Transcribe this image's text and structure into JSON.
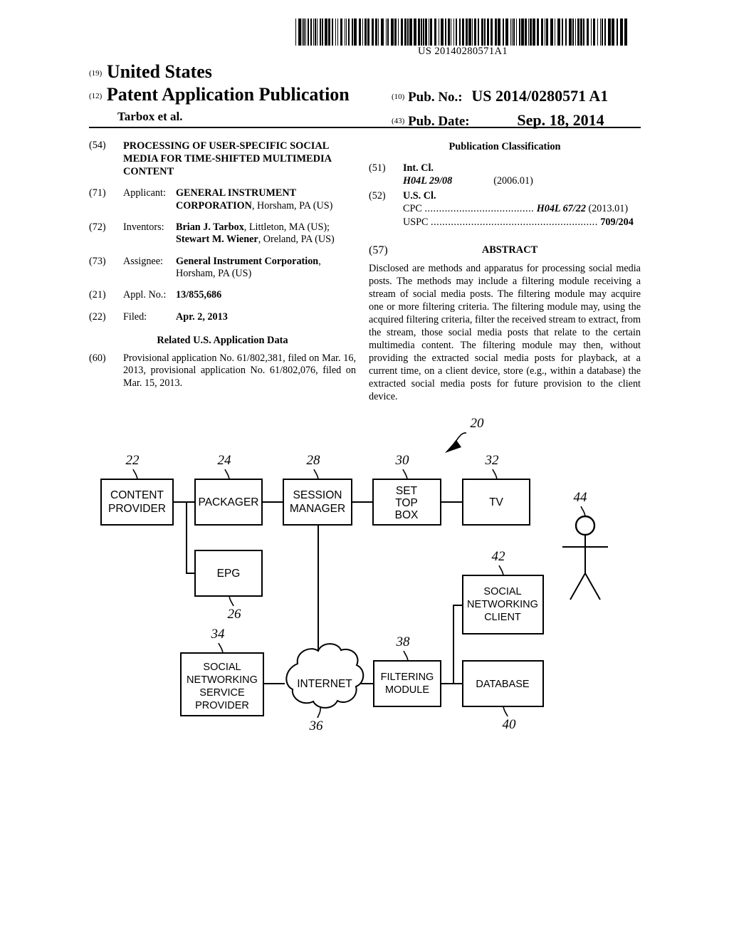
{
  "barcode": {
    "publication_number_text": "US 20140280571A1"
  },
  "masthead": {
    "code_19": "(19)",
    "country": "United States",
    "code_12": "(12)",
    "doc_type": "Patent Application Publication",
    "authors": "Tarbox et al.",
    "code_10": "(10)",
    "pub_no_label": "Pub. No.:",
    "pub_no_value": "US 2014/0280571 A1",
    "code_43": "(43)",
    "pub_date_label": "Pub. Date:",
    "pub_date_value": "Sep. 18, 2014"
  },
  "left_column": {
    "title": {
      "code": "(54)",
      "text": "PROCESSING OF USER-SPECIFIC SOCIAL MEDIA FOR TIME-SHIFTED MULTIMEDIA CONTENT"
    },
    "applicant": {
      "code": "(71)",
      "label": "Applicant:",
      "name": "GENERAL INSTRUMENT CORPORATION",
      "location": ", Horsham, PA (US)"
    },
    "inventors": {
      "code": "(72)",
      "label": "Inventors:",
      "entries": [
        {
          "name": "Brian J. Tarbox",
          "location": ", Littleton, MA (US);"
        },
        {
          "name": "Stewart M. Wiener",
          "location": ", Oreland, PA (US)"
        }
      ]
    },
    "assignee": {
      "code": "(73)",
      "label": "Assignee:",
      "name": "General Instrument Corporation",
      "location": ",",
      "location2": "Horsham, PA (US)"
    },
    "appl_no": {
      "code": "(21)",
      "label": "Appl. No.:",
      "value": "13/855,686"
    },
    "filed": {
      "code": "(22)",
      "label": "Filed:",
      "value": "Apr. 2, 2013"
    },
    "related_heading": "Related U.S. Application Data",
    "related": {
      "code": "(60)",
      "text": "Provisional application No. 61/802,381, filed on Mar. 16, 2013, provisional application No. 61/802,076, filed on Mar. 15, 2013."
    }
  },
  "right_column": {
    "pub_class_heading": "Publication Classification",
    "int_cl": {
      "code": "(51)",
      "label": "Int. Cl.",
      "symbol": "H04L 29/08",
      "version": "(2006.01)"
    },
    "us_cl": {
      "code": "(52)",
      "label": "U.S. Cl.",
      "cpc_label": "CPC",
      "cpc_dots": "......................................",
      "cpc_value": "H04L 67/22",
      "cpc_version": "(2013.01)",
      "uspc_label": "USPC",
      "uspc_dots": "..........................................................",
      "uspc_value": "709/204"
    },
    "abstract": {
      "code": "(57)",
      "heading": "ABSTRACT",
      "text": "Disclosed are methods and apparatus for processing social media posts. The methods may include a filtering module receiving a stream of social media posts. The filtering module may acquire one or more filtering criteria. The filtering module may, using the acquired filtering criteria, filter the received stream to extract, from the stream, those social media posts that relate to the certain multimedia content. The filtering module may then, without providing the extracted social media posts for playback, at a current time, on a client device, store (e.g., within a database) the extracted social media posts for future provision to the client device."
    }
  },
  "figure": {
    "system_ref": "20",
    "nodes": [
      {
        "id": "content-provider",
        "ref": "22",
        "lines": [
          "CONTENT",
          "PROVIDER"
        ]
      },
      {
        "id": "packager",
        "ref": "24",
        "lines": [
          "PACKAGER"
        ]
      },
      {
        "id": "epg",
        "ref": "26",
        "lines": [
          "EPG"
        ]
      },
      {
        "id": "session-manager",
        "ref": "28",
        "lines": [
          "SESSION",
          "MANAGER"
        ]
      },
      {
        "id": "set-top-box",
        "ref": "30",
        "lines": [
          "SET",
          "TOP",
          "BOX"
        ]
      },
      {
        "id": "tv",
        "ref": "32",
        "lines": [
          "TV"
        ]
      },
      {
        "id": "social-networking-service-provider",
        "ref": "34",
        "lines": [
          "SOCIAL",
          "NETWORKING",
          "SERVICE",
          "PROVIDER"
        ]
      },
      {
        "id": "internet",
        "ref": "36",
        "lines": [
          "INTERNET"
        ]
      },
      {
        "id": "filtering-module",
        "ref": "38",
        "lines": [
          "FILTERING",
          "MODULE"
        ]
      },
      {
        "id": "database",
        "ref": "40",
        "lines": [
          "DATABASE"
        ]
      },
      {
        "id": "social-networking-client",
        "ref": "42",
        "lines": [
          "SOCIAL",
          "NETWORKING",
          "CLIENT"
        ]
      },
      {
        "id": "user",
        "ref": "44",
        "lines": []
      }
    ]
  }
}
